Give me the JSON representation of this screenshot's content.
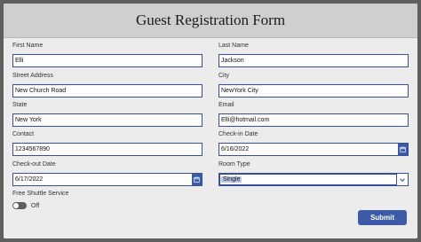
{
  "form": {
    "title": "Guest Registration Form",
    "first_name": {
      "label": "First Name",
      "value": "Elli"
    },
    "last_name": {
      "label": "Last Name",
      "value": "Jackson"
    },
    "street_address": {
      "label": "Street Address",
      "value": "New Church Road"
    },
    "city": {
      "label": "City",
      "value": "NewYork City"
    },
    "state": {
      "label": "State",
      "value": "New York"
    },
    "email": {
      "label": "Email",
      "value": "Elli@hotmail.com"
    },
    "contact": {
      "label": "Contact",
      "value": "1234567890"
    },
    "checkin": {
      "label": "Check-in Date",
      "value": "6/16/2022",
      "icon": "calendar-icon"
    },
    "checkout": {
      "label": "Check-out Date",
      "value": "6/17/2022",
      "icon": "calendar-icon"
    },
    "room_type": {
      "label": "Room Type",
      "value": "Single",
      "icon": "chevron-down-icon"
    },
    "shuttle": {
      "label": "Free Shuttle Service",
      "state_text": "Off"
    },
    "submit_label": "Submit"
  },
  "colors": {
    "accent": "#3b5aa8",
    "field_border": "#3a4f9a",
    "header_bg": "#cfcfcf",
    "page_bg": "#ececec",
    "outer_bg": "#5f5f5f"
  }
}
